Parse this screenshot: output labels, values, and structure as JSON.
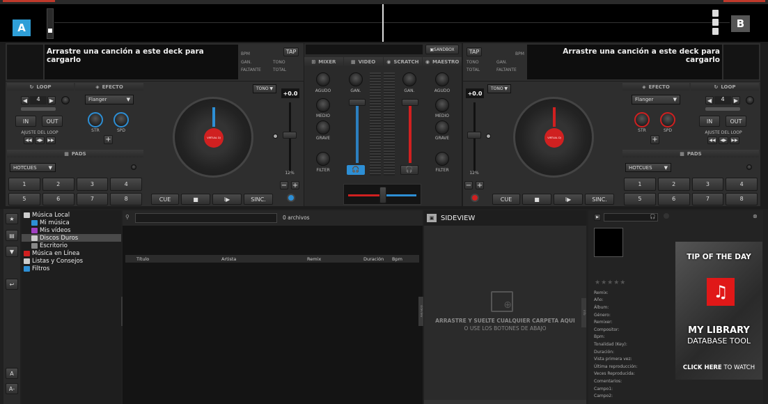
{
  "deckA": {
    "letter": "A",
    "empty_text": "Arrastre una canción a este deck para cargarlo",
    "bpm": "BPM",
    "tap": "TAP",
    "gan": "GAN.",
    "tono": "TONO",
    "faltante": "FALTANTE",
    "total": "TOTAL",
    "loop_label": "LOOP",
    "efecto_label": "EFECTO",
    "loop_value": "4",
    "in": "IN",
    "out": "OUT",
    "ajuste": "AJUSTE DEL LOOP",
    "effect": "Flanger",
    "str": "STR",
    "spd": "SPD",
    "pads_label": "PADS",
    "pads_mode": "HOTCUES",
    "pads": [
      "1",
      "2",
      "3",
      "4",
      "5",
      "6",
      "7",
      "8"
    ],
    "tono_btn": "TONO",
    "pitch": "+0.0",
    "pitch_range": "12%",
    "cue": "CUE",
    "stop": "■",
    "play": "I▶",
    "sync": "SINC.",
    "platter_label": "VIRTUAL DJ"
  },
  "deckB": {
    "letter": "B",
    "empty_text": "Arrastre una canción a este deck para cargarlo",
    "bpm": "BPM",
    "tap": "TAP",
    "gan": "GAN.",
    "tono": "TONO",
    "faltante": "FALTANTE",
    "total": "TOTAL",
    "loop_label": "LOOP",
    "efecto_label": "EFECTO",
    "loop_value": "4",
    "in": "IN",
    "out": "OUT",
    "ajuste": "AJUSTE DEL LOOP",
    "effect": "Flanger",
    "str": "STR",
    "spd": "SPD",
    "pads_label": "PADS",
    "pads_mode": "HOTCUES",
    "pads": [
      "1",
      "2",
      "3",
      "4",
      "5",
      "6",
      "7",
      "8"
    ],
    "tono_btn": "TONO",
    "pitch": "+0.0",
    "pitch_range": "12%",
    "cue": "CUE",
    "stop": "■",
    "play": "I▶",
    "sync": "SINC.",
    "platter_label": "VIRTUAL DJ"
  },
  "mixer": {
    "sandbox": "SANDBOX",
    "tabs": [
      "MIXER",
      "VIDEO",
      "SCRATCH",
      "MAESTRO"
    ],
    "agudo": "AGUDO",
    "medio": "MEDIO",
    "grave": "GRAVE",
    "filter": "FILTER",
    "gan": "GAN."
  },
  "browser": {
    "tree": [
      "Música Local",
      "Mi música",
      "Mis vídeos",
      "Discos Duros",
      "Escritorio",
      "Música en Línea",
      "Listas y Consejos",
      "Filtros"
    ],
    "files_count": "0 archivos",
    "columns": [
      "Título",
      "Artista",
      "Remix",
      "Duración",
      "Bpm"
    ],
    "folders_tab": "folders",
    "sideview_tab": "sideview",
    "info_tab": "info",
    "side_buttons": [
      "A",
      "A-"
    ]
  },
  "sideview": {
    "title": "SIDEVIEW",
    "hint1": "ARRASTRE Y SUELTE CUALQUIER CARPETA AQUI",
    "hint2": "O USE LOS BOTONES DE ABAJO"
  },
  "info": {
    "stars": "★★★★★",
    "fields": [
      "Remix:",
      "Año:",
      "Álbum:",
      "Género:",
      "Remixer:",
      "Compositor:",
      "Bpm:",
      "Tonalidad (Key):",
      "Duración:",
      "Vista primera vez:",
      "Última reproducción:",
      "Veces Reproducida:",
      "Comentarios:",
      "Campo1:",
      "Campo2:"
    ]
  },
  "tip": {
    "title": "TIP OF THE DAY",
    "line1": "MY LIBRARY",
    "line2": "DATABASE TOOL",
    "cta_bold": "CLICK HERE",
    "cta_rest": "TO WATCH"
  }
}
